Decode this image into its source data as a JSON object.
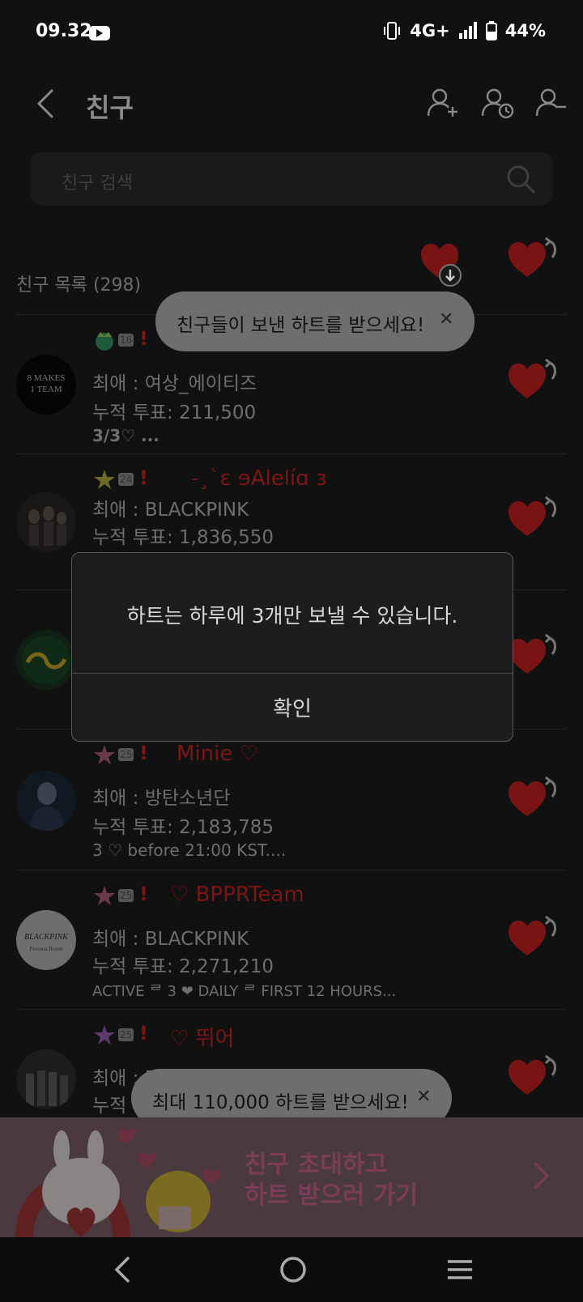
{
  "status_bar": {
    "time": "09.32",
    "network": "4G+",
    "battery": "44%"
  },
  "header": {
    "title": "친구"
  },
  "search": {
    "placeholder": "친구 검색"
  },
  "friends_list": {
    "count_label": "친구 목록 (298)"
  },
  "tooltip_top": {
    "text": "친구들이 보낸 하트를 받으세요!"
  },
  "tooltip_bottom": {
    "text": "최대 110,000 하트를 받으세요!"
  },
  "friends": [
    {
      "level": "16",
      "nickname": "",
      "favorite": "최애 : 여상_에이티즈",
      "votes": "누적 투표: 211,500",
      "status": "3/3♡ ..."
    },
    {
      "level": "24",
      "nickname": "-¸`ɛ ɘAlelíɑ ɜ",
      "favorite": "최애 : BLACKPINK",
      "votes": "누적 투표: 1,836,550",
      "status": ""
    },
    {
      "level": "",
      "nickname": "",
      "favorite": "",
      "votes": "",
      "status": ""
    },
    {
      "level": "25",
      "nickname": "Minie ♡",
      "favorite": "최애 : 방탄소년단",
      "votes": "누적 투표: 2,183,785",
      "status": "3 ♡ before 21:00 KST...."
    },
    {
      "level": "25",
      "nickname": "♡ BPPRTeam",
      "favorite": "최애 : BLACKPINK",
      "votes": "누적 투표: 2,271,210",
      "status": "ACTIVE ᄅ 3 ❤ DAILY ᄅ FIRST 12 HOURS..."
    },
    {
      "level": "25",
      "nickname": "♡ 뛰어",
      "favorite": "최애 : BLACKPINK",
      "votes": "누적 투표: 2,",
      "status": ""
    }
  ],
  "avatar_texts": {
    "ateez": "8 MAKES 1 TEAM",
    "bppr": "BLACKPINK Persona Room"
  },
  "dialog": {
    "message": "하트는 하루에 3개만 보낼 수 있습니다.",
    "ok_label": "확인"
  },
  "banner": {
    "line1": "친구 초대하고",
    "line2": "하트 받으러 가기"
  },
  "colors": {
    "heart": "#7a1414",
    "nickname": "#7c1515",
    "tooltip": "#6e6e6e",
    "dialog_bg": "#1d1d1d",
    "banner_text": "#7b3d55"
  },
  "icons": {
    "back": "back-arrow-icon",
    "add_friend": "add-friend-icon",
    "pending_friend": "friend-clock-icon",
    "remove_friend": "remove-friend-icon",
    "search": "search-icon",
    "heart": "heart-icon",
    "return": "return-arrow-icon"
  }
}
